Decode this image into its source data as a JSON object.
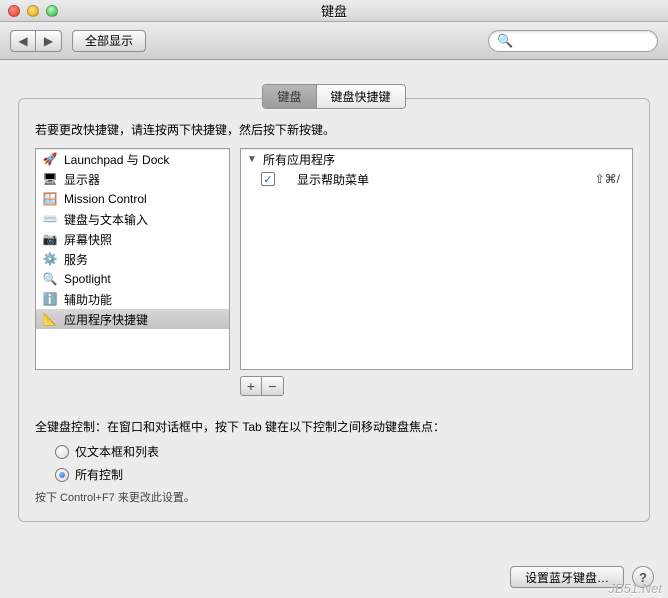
{
  "window": {
    "title": "键盘"
  },
  "toolbar": {
    "show_all": "全部显示",
    "search_placeholder": ""
  },
  "tabs": {
    "keyboard": "键盘",
    "shortcuts": "键盘快捷键"
  },
  "panel": {
    "instruction": "若要更改快捷键，请连按两下快捷键，然后按下新按键。"
  },
  "categories": [
    {
      "icon": "🚀",
      "label": "Launchpad 与 Dock",
      "selected": false
    },
    {
      "icon": "🖥",
      "label": "显示器",
      "selected": false
    },
    {
      "icon": "🪟",
      "label": "Mission Control",
      "selected": false
    },
    {
      "icon": "⌨️",
      "label": "键盘与文本输入",
      "selected": false
    },
    {
      "icon": "📷",
      "label": "屏幕快照",
      "selected": false
    },
    {
      "icon": "⚙️",
      "label": "服务",
      "selected": false
    },
    {
      "icon": "🔍",
      "label": "Spotlight",
      "selected": false
    },
    {
      "icon": "ℹ️",
      "label": "辅助功能",
      "selected": false
    },
    {
      "icon": "📐",
      "label": "应用程序快捷键",
      "selected": true
    }
  ],
  "shortcuts": {
    "group_label": "所有应用程序",
    "items": [
      {
        "checked": true,
        "label": "显示帮助菜单",
        "keys": "⇧⌘/"
      }
    ]
  },
  "fka": {
    "heading": "全键盘控制：在窗口和对话框中，按下 Tab 键在以下控制之间移动键盘焦点：",
    "opt_text_only": "仅文本框和列表",
    "opt_all": "所有控制",
    "hint": "按下 Control+F7 来更改此设置。"
  },
  "footer": {
    "bluetooth": "设置蓝牙键盘…"
  },
  "watermark": "JB51.Net"
}
